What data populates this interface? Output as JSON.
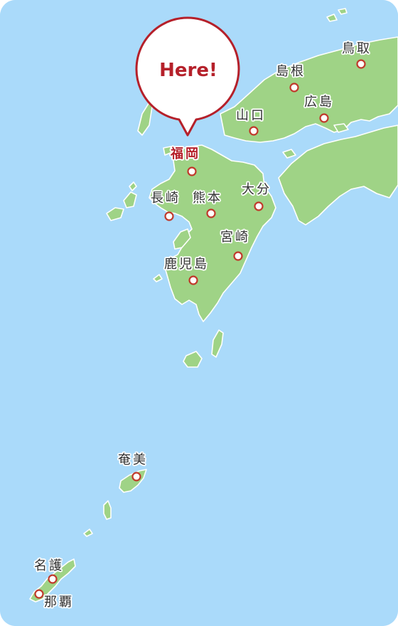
{
  "map": {
    "colors": {
      "sea": "#aadafa",
      "land": "#9fd386",
      "coast": "#ffffff",
      "marker": "#c0392b",
      "highlight_text": "#b5202a",
      "label_text": "#333333"
    },
    "callout": {
      "text": "Here!",
      "city": "福岡"
    },
    "cities": [
      {
        "id": "fukuoka",
        "name": "福岡",
        "highlighted": true
      },
      {
        "id": "nagasaki",
        "name": "長崎",
        "highlighted": false
      },
      {
        "id": "kumamoto",
        "name": "熊本",
        "highlighted": false
      },
      {
        "id": "oita",
        "name": "大分",
        "highlighted": false
      },
      {
        "id": "miyazaki",
        "name": "宮崎",
        "highlighted": false
      },
      {
        "id": "kagoshima",
        "name": "鹿児島",
        "highlighted": false
      },
      {
        "id": "yamaguchi",
        "name": "山口",
        "highlighted": false
      },
      {
        "id": "shimane",
        "name": "島根",
        "highlighted": false
      },
      {
        "id": "tottori",
        "name": "鳥取",
        "highlighted": false
      },
      {
        "id": "hiroshima",
        "name": "広島",
        "highlighted": false
      },
      {
        "id": "amami",
        "name": "奄美",
        "highlighted": false
      },
      {
        "id": "nago",
        "name": "名護",
        "highlighted": false
      },
      {
        "id": "naha",
        "name": "那覇",
        "highlighted": false
      }
    ]
  }
}
